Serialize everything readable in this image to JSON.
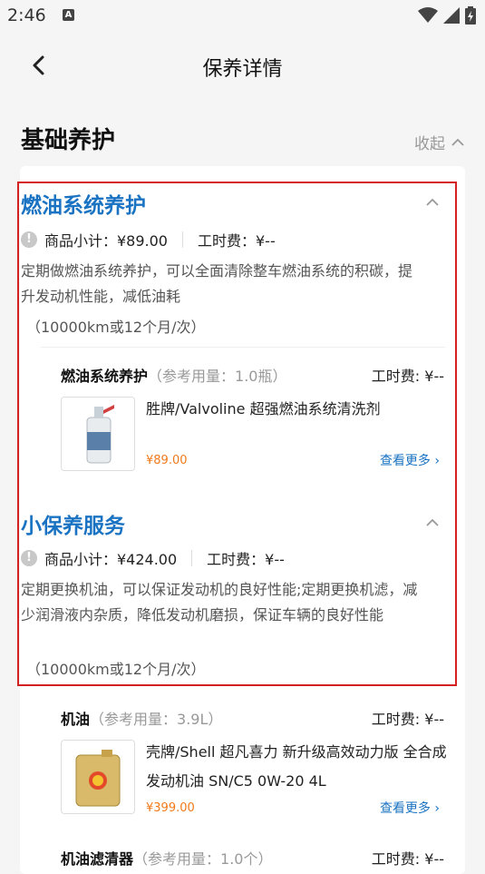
{
  "status_bar": {
    "time": "2:46",
    "notification_icon": "A"
  },
  "header": {
    "title": "保养详情"
  },
  "section": {
    "title": "基础养护",
    "collapse_label": "收起"
  },
  "colors": {
    "accent": "#1a73c2",
    "price": "#f07a1a",
    "highlight_border": "#d32020"
  },
  "groups": [
    {
      "title": "燃油系统养护",
      "subtotal": "商品小计：¥89.00",
      "labor": "工时费：¥--",
      "description": "定期做燃油系统养护，可以全面清除整车燃油系统的积碳，提升发动机性能，减低油耗",
      "frequency": "（10000km或12个月/次）",
      "items": [
        {
          "name": "燃油系统养护",
          "amount": "（参考用量：1.0瓶）",
          "labor": "工时费: ¥--",
          "product": "胜牌/Valvoline 超强燃油系统清洗剂",
          "price": "¥89.00",
          "more": "查看更多"
        }
      ]
    },
    {
      "title": "小保养服务",
      "subtotal": "商品小计：¥424.00",
      "labor": "工时费：¥--",
      "description": "定期更换机油，可以保证发动机的良好性能;定期更换机滤，减少润滑液内杂质，降低发动机磨损，保证车辆的良好性能",
      "frequency": "（10000km或12个月/次）",
      "items": [
        {
          "name": "机油",
          "amount": "（参考用量：3.9L）",
          "labor": "工时费: ¥--",
          "product": "壳牌/Shell 超凡喜力 新升级高效动力版 全合成发动机油 SN/C5 0W-20 4L",
          "price": "¥399.00",
          "more": "查看更多"
        },
        {
          "name": "机油滤清器",
          "amount": "（参考用量：1.0个）",
          "labor": "工时费: ¥--"
        }
      ]
    }
  ]
}
